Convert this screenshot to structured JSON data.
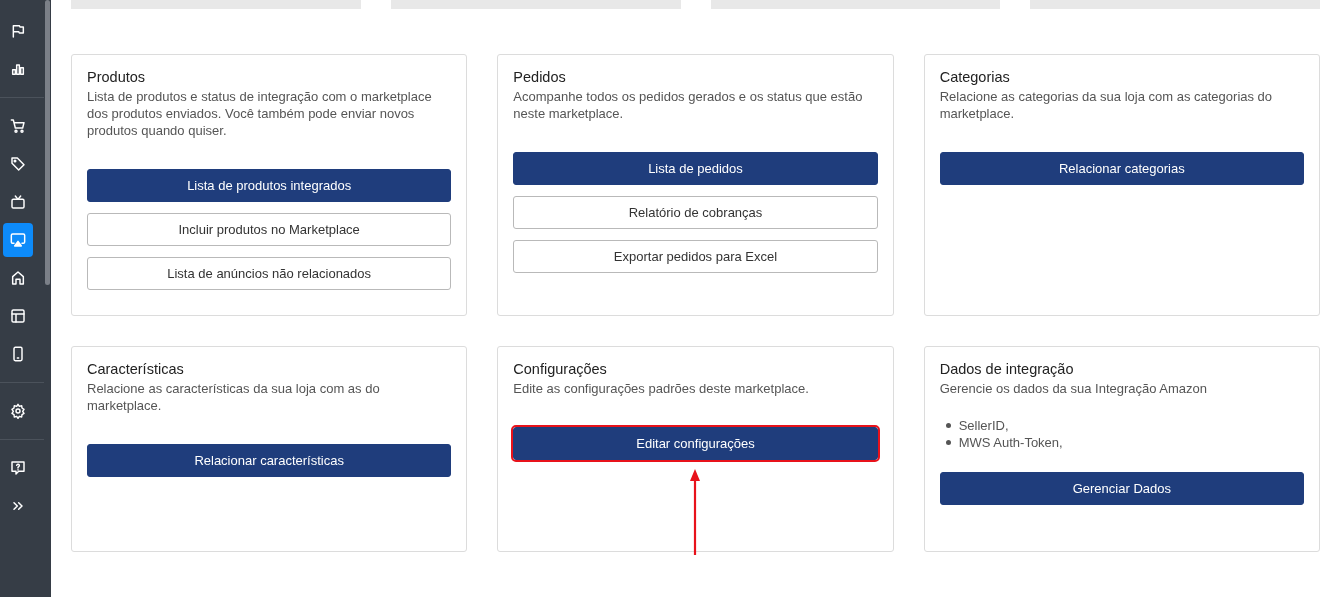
{
  "sidebar": {
    "groups": [
      {
        "items": [
          {
            "selected": false
          },
          {
            "selected": false
          }
        ]
      },
      {
        "items": [
          {
            "selected": false
          },
          {
            "selected": false
          },
          {
            "selected": false
          },
          {
            "selected": true
          },
          {
            "selected": false
          },
          {
            "selected": false
          },
          {
            "selected": false
          }
        ]
      },
      {
        "items": [
          {
            "selected": false
          }
        ]
      },
      {
        "items": [
          {
            "selected": false
          },
          {
            "selected": false
          }
        ]
      }
    ]
  },
  "cards": [
    {
      "title": "Produtos",
      "description": "Lista de produtos e status de integração com o marketplace dos produtos enviados. Você também pode enviar novos produtos quando quiser.",
      "buttons": [
        {
          "label": "Lista de produtos integrados",
          "kind": "primary",
          "highlighted": false
        },
        {
          "label": "Incluir produtos no Marketplace",
          "kind": "outline",
          "highlighted": false
        },
        {
          "label": "Lista de anúncios não relacionados",
          "kind": "outline",
          "highlighted": false
        }
      ]
    },
    {
      "title": "Pedidos",
      "description": "Acompanhe todos os pedidos gerados e os status que estão neste marketplace.",
      "buttons": [
        {
          "label": "Lista de pedidos",
          "kind": "primary",
          "highlighted": false
        },
        {
          "label": "Relatório de cobranças",
          "kind": "outline",
          "highlighted": false
        },
        {
          "label": "Exportar pedidos para Excel",
          "kind": "outline",
          "highlighted": false
        }
      ]
    },
    {
      "title": "Categorias",
      "description": "Relacione as categorias da sua loja com as categorias do marketplace.",
      "buttons": [
        {
          "label": "Relacionar categorias",
          "kind": "primary",
          "highlighted": false
        }
      ]
    },
    {
      "title": "Características",
      "description": "Relacione as características da sua loja com as do marketplace.",
      "buttons": [
        {
          "label": "Relacionar características",
          "kind": "primary",
          "highlighted": false
        }
      ]
    },
    {
      "title": "Configurações",
      "description": "Edite as configurações padrões deste marketplace.",
      "buttons": [
        {
          "label": "Editar configurações",
          "kind": "primary",
          "highlighted": true
        }
      ]
    },
    {
      "title": "Dados de integração",
      "description": "Gerencie os dados da sua Integração Amazon",
      "list": [
        "SellerID,",
        "MWS Auth-Token,"
      ],
      "buttons": [
        {
          "label": "Gerenciar Dados",
          "kind": "primary",
          "highlighted": false
        }
      ]
    }
  ]
}
